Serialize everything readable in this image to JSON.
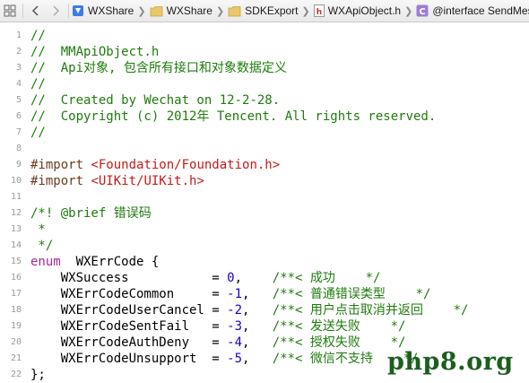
{
  "jumpbar": {
    "crumbs": [
      {
        "label": "WXShare"
      },
      {
        "label": "WXShare"
      },
      {
        "label": "SDKExport"
      },
      {
        "label": "WXApiObject.h"
      },
      {
        "label": "@interface SendMessag"
      }
    ]
  },
  "editor": {
    "lines": [
      {
        "n": "1",
        "tokens": [
          {
            "t": "//",
            "k": "comment"
          }
        ]
      },
      {
        "n": "2",
        "tokens": [
          {
            "t": "//  MMApiObject.h",
            "k": "comment"
          }
        ]
      },
      {
        "n": "3",
        "tokens": [
          {
            "t": "//  Api对象, 包含所有接口和对象数据定义",
            "k": "comment"
          }
        ]
      },
      {
        "n": "4",
        "tokens": [
          {
            "t": "//",
            "k": "comment"
          }
        ]
      },
      {
        "n": "5",
        "tokens": [
          {
            "t": "//  Created by Wechat on 12-2-28.",
            "k": "comment"
          }
        ]
      },
      {
        "n": "6",
        "tokens": [
          {
            "t": "//  Copyright (c) 2012年 Tencent. All rights reserved.",
            "k": "comment"
          }
        ]
      },
      {
        "n": "7",
        "tokens": [
          {
            "t": "//",
            "k": "comment"
          }
        ]
      },
      {
        "n": "8",
        "tokens": []
      },
      {
        "n": "9",
        "tokens": [
          {
            "t": "#import ",
            "k": "pp"
          },
          {
            "t": "<Foundation/Foundation.h>",
            "k": "str"
          }
        ]
      },
      {
        "n": "10",
        "tokens": [
          {
            "t": "#import ",
            "k": "pp"
          },
          {
            "t": "<UIKit/UIKit.h>",
            "k": "str"
          }
        ]
      },
      {
        "n": "11",
        "tokens": []
      },
      {
        "n": "12",
        "tokens": [
          {
            "t": "/*! @brief 错误码",
            "k": "comment"
          }
        ]
      },
      {
        "n": "13",
        "tokens": [
          {
            "t": " *",
            "k": "comment"
          }
        ]
      },
      {
        "n": "14",
        "tokens": [
          {
            "t": " */",
            "k": "comment"
          }
        ]
      },
      {
        "n": "15",
        "tokens": [
          {
            "t": "enum",
            "k": "kw"
          },
          {
            "t": "  WXErrCode {",
            "k": "plain"
          }
        ]
      },
      {
        "n": "16",
        "tokens": [
          {
            "t": "    WXSuccess           = ",
            "k": "plain"
          },
          {
            "t": "0",
            "k": "num"
          },
          {
            "t": ",    ",
            "k": "plain"
          },
          {
            "t": "/**< 成功    */",
            "k": "comment"
          }
        ]
      },
      {
        "n": "17",
        "tokens": [
          {
            "t": "    WXErrCodeCommon     = ",
            "k": "plain"
          },
          {
            "t": "-1",
            "k": "num"
          },
          {
            "t": ",   ",
            "k": "plain"
          },
          {
            "t": "/**< 普通错误类型    */",
            "k": "comment"
          }
        ]
      },
      {
        "n": "18",
        "tokens": [
          {
            "t": "    WXErrCodeUserCancel = ",
            "k": "plain"
          },
          {
            "t": "-2",
            "k": "num"
          },
          {
            "t": ",   ",
            "k": "plain"
          },
          {
            "t": "/**< 用户点击取消并返回    */",
            "k": "comment"
          }
        ]
      },
      {
        "n": "19",
        "tokens": [
          {
            "t": "    WXErrCodeSentFail   = ",
            "k": "plain"
          },
          {
            "t": "-3",
            "k": "num"
          },
          {
            "t": ",   ",
            "k": "plain"
          },
          {
            "t": "/**< 发送失败    */",
            "k": "comment"
          }
        ]
      },
      {
        "n": "20",
        "tokens": [
          {
            "t": "    WXErrCodeAuthDeny   = ",
            "k": "plain"
          },
          {
            "t": "-4",
            "k": "num"
          },
          {
            "t": ",   ",
            "k": "plain"
          },
          {
            "t": "/**< 授权失败    */",
            "k": "comment"
          }
        ]
      },
      {
        "n": "21",
        "tokens": [
          {
            "t": "    WXErrCodeUnsupport  = ",
            "k": "plain"
          },
          {
            "t": "-5",
            "k": "num"
          },
          {
            "t": ",   ",
            "k": "plain"
          },
          {
            "t": "/**< 微信不支持    */",
            "k": "comment"
          }
        ]
      },
      {
        "n": "22",
        "tokens": [
          {
            "t": "};",
            "k": "plain"
          }
        ]
      }
    ]
  },
  "watermark": {
    "text": "php8.org"
  }
}
